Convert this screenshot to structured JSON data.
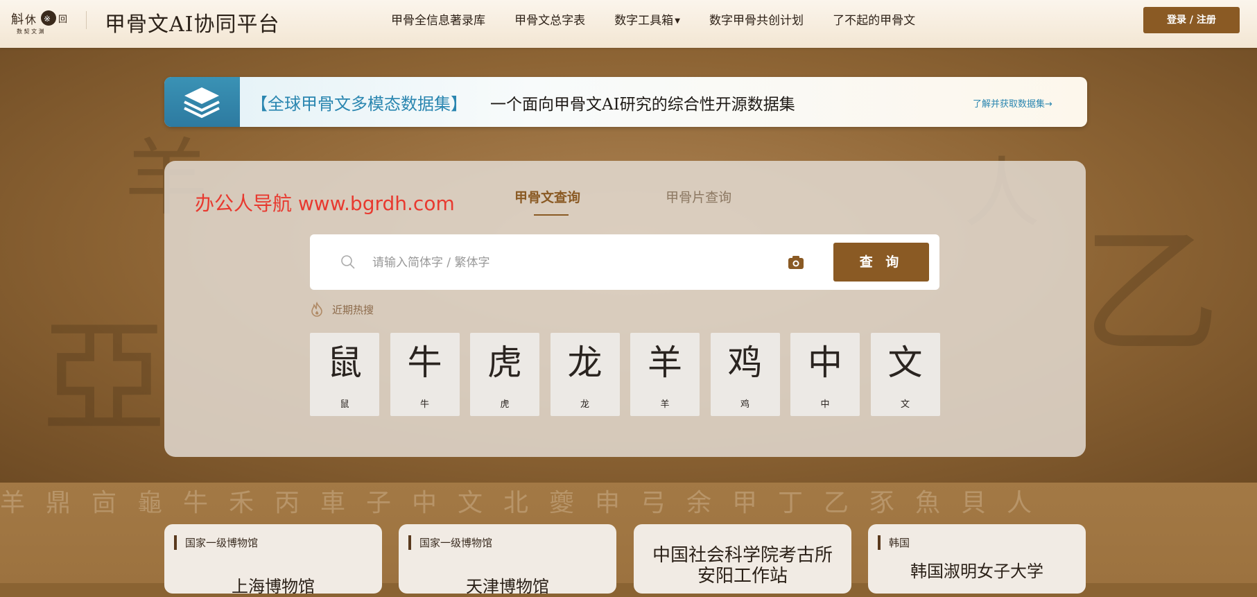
{
  "header": {
    "site_title": "甲骨文AI协同平台",
    "nav": [
      {
        "label": "甲骨全信息著录库"
      },
      {
        "label": "甲骨文总字表"
      },
      {
        "label": "数字工具箱",
        "dropdown": true
      },
      {
        "label": "数字甲骨共创计划"
      },
      {
        "label": "了不起的甲骨文"
      }
    ],
    "login_label": "登录 / 注册"
  },
  "banner": {
    "title": "【全球甲骨文多模态数据集】",
    "description": "一个面向甲骨文AI研究的综合性开源数据集",
    "link": "了解并获取数据集→"
  },
  "search_panel": {
    "watermark": "办公人导航  www.bgrdh.com",
    "tabs": [
      {
        "label": "甲骨文查询",
        "active": true
      },
      {
        "label": "甲骨片查询",
        "active": false
      }
    ],
    "search": {
      "placeholder": "请输入简体字 / 繁体字",
      "value": "",
      "button_label": "查 询"
    },
    "hot_label": "近期热搜",
    "hot_chars": [
      {
        "glyph": "鼠",
        "name": "鼠"
      },
      {
        "glyph": "牛",
        "name": "牛"
      },
      {
        "glyph": "虎",
        "name": "虎"
      },
      {
        "glyph": "龙",
        "name": "龙"
      },
      {
        "glyph": "羊",
        "name": "羊"
      },
      {
        "glyph": "鸡",
        "name": "鸡"
      },
      {
        "glyph": "中",
        "name": "中"
      },
      {
        "glyph": "文",
        "name": "文"
      }
    ]
  },
  "museums": [
    {
      "tag": "国家一级博物馆",
      "name": "上海博物馆"
    },
    {
      "tag": "国家一级博物馆",
      "name": "天津博物馆"
    },
    {
      "tag": "",
      "name_lines": [
        "中国社会科学院考古所",
        "安阳工作站"
      ]
    },
    {
      "tag": "韩国",
      "name": "韩国淑明女子大学"
    }
  ],
  "colors": {
    "accent_brown": "#8a5a24",
    "banner_blue": "#2a86b0",
    "watermark_red": "#e8392f"
  }
}
